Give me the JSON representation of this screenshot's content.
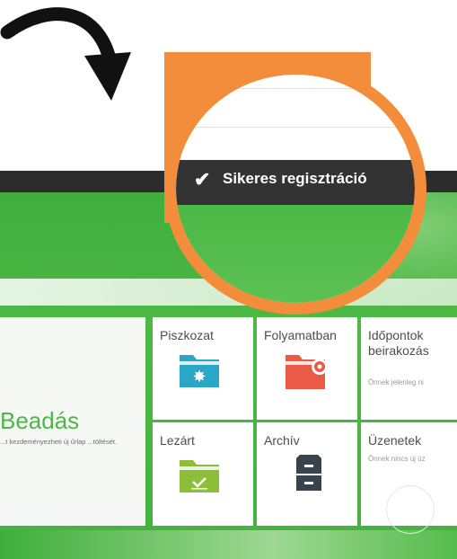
{
  "toast": {
    "message": "Sikeres regisztráció"
  },
  "submit_tile": {
    "title": "Beadás",
    "description": "...t kezdeményezheti új űrlap ...töltését."
  },
  "tiles": [
    {
      "label": "Piszkozat",
      "icon": "folder-star-icon",
      "color": "#2aa7c7"
    },
    {
      "label": "Folyamatban",
      "icon": "folder-gear-icon",
      "color": "#ea5a44"
    },
    {
      "label": "Lezárt",
      "icon": "folder-check-icon",
      "color": "#8cbe3a"
    },
    {
      "label": "Archív",
      "icon": "archive-cabinet-icon",
      "color": "#37434f"
    }
  ],
  "appointments": {
    "title_line1": "Időpontok",
    "title_line2": "beirakozás",
    "subtitle": "Önnek jelenleg ni"
  },
  "messages": {
    "title": "Üzenetek",
    "subtitle": "Önnek nincs új üz"
  }
}
